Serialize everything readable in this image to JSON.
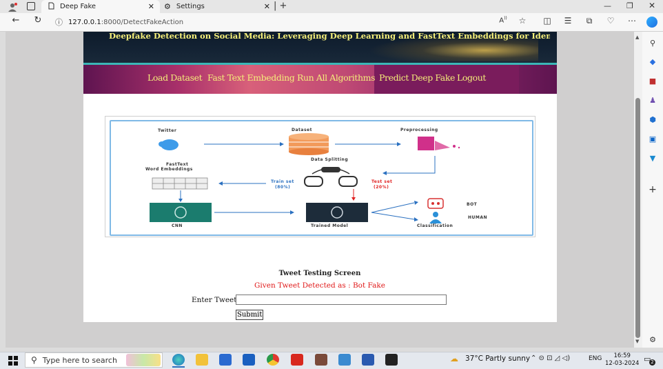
{
  "browser": {
    "tabs": [
      {
        "title": "Deep Fake",
        "active": true
      },
      {
        "title": "Settings",
        "active": false
      }
    ],
    "url_host": "127.0.0.1",
    "url_path": ":8000/DetectFakeAction",
    "read_aloud_label": "A̧"
  },
  "page": {
    "site_title": "Deepfake Detection on Social Media: Leveraging Deep Learning and FastText Embeddings for Identifying Machine-",
    "menu": [
      "Load Dataset",
      "Fast Text Embedding",
      "Run All Algorithms",
      "Predict Deep Fake",
      "Logout"
    ],
    "diagram": {
      "twitter": "Twitter",
      "dataset": "Dataset",
      "preprocessing": "Preprocessing",
      "fasttext_l1": "FastText",
      "fasttext_l2": "Word Embeddings",
      "data_splitting": "Data Splitting",
      "train_set": "Train set",
      "train_pct": "(80%)",
      "test_set": "Test set",
      "test_pct": "(20%)",
      "cnn": "CNN",
      "trained_model": "Trained Model",
      "bot": "BOT",
      "human": "HUMAN",
      "classification": "Classification"
    },
    "screen_title": "Tweet Testing Screen",
    "result_text": "Given Tweet Detected as : Bot Fake",
    "tweet_label": "Enter Tweets",
    "tweet_value": "",
    "submit_label": "Submit"
  },
  "taskbar": {
    "search_placeholder": "Type here to search",
    "weather": "37°C  Partly sunny",
    "language": "ENG",
    "time": "16:59",
    "date": "12-03-2024",
    "notification_count": "2"
  },
  "colors": {
    "title_yellow": "#f6f07a",
    "menu_yellow": "#f4ec7a",
    "result_red": "#e01818",
    "accent_teal": "#3bb7b7"
  }
}
